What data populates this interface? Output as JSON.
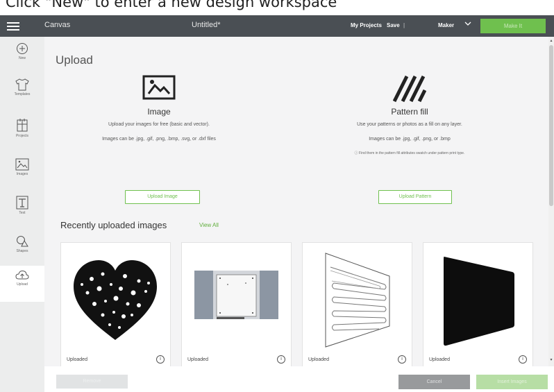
{
  "caption": {
    "text": "Click \"New\" to enter a new design workspace"
  },
  "topbar": {
    "canvas_label": "Canvas",
    "doc_title": "Untitled*",
    "my_projects": "My Projects",
    "save": "Save",
    "separator": "|",
    "machine": "Maker",
    "make_it": "Make It",
    "accent_color": "#6fc04e",
    "bar_color": "#4a4f54"
  },
  "sidebar": {
    "items": [
      {
        "label": "New",
        "icon": "plus-circle-icon"
      },
      {
        "label": "Templates",
        "icon": "shirt-icon"
      },
      {
        "label": "Projects",
        "icon": "projects-icon"
      },
      {
        "label": "Images",
        "icon": "image-icon"
      },
      {
        "label": "Text",
        "icon": "text-icon"
      },
      {
        "label": "Shapes",
        "icon": "shapes-icon"
      },
      {
        "label": "Upload",
        "icon": "upload-icon"
      }
    ],
    "active": "Upload"
  },
  "upload": {
    "title": "Upload",
    "image": {
      "heading": "Image",
      "desc1": "Upload your images for free (basic and vector).",
      "desc2": "Images can be .jpg, .gif, .png, .bmp, .svg, or .dxf files",
      "button": "Upload Image"
    },
    "pattern": {
      "heading": "Pattern fill",
      "desc1": "Use your patterns or photos as a fill on any layer.",
      "desc2": "Images can be .jpg, .gif, .png, or .bmp",
      "note": "ⓘ Find them in the pattern fill attributes swatch under pattern print type.",
      "button": "Upload Pattern"
    }
  },
  "recent": {
    "title": "Recently uploaded images",
    "view_all": "View All",
    "cards": [
      {
        "label": "Uploaded",
        "thumb": "heart-of-hearts"
      },
      {
        "label": "Uploaded",
        "thumb": "panel-photo"
      },
      {
        "label": "Uploaded",
        "thumb": "zigzag-outline"
      },
      {
        "label": "Uploaded",
        "thumb": "black-trapezoid"
      }
    ],
    "info_glyph": "i"
  },
  "footer": {
    "remove": "Remove",
    "cancel": "Cancel",
    "insert": "Insert Images"
  }
}
